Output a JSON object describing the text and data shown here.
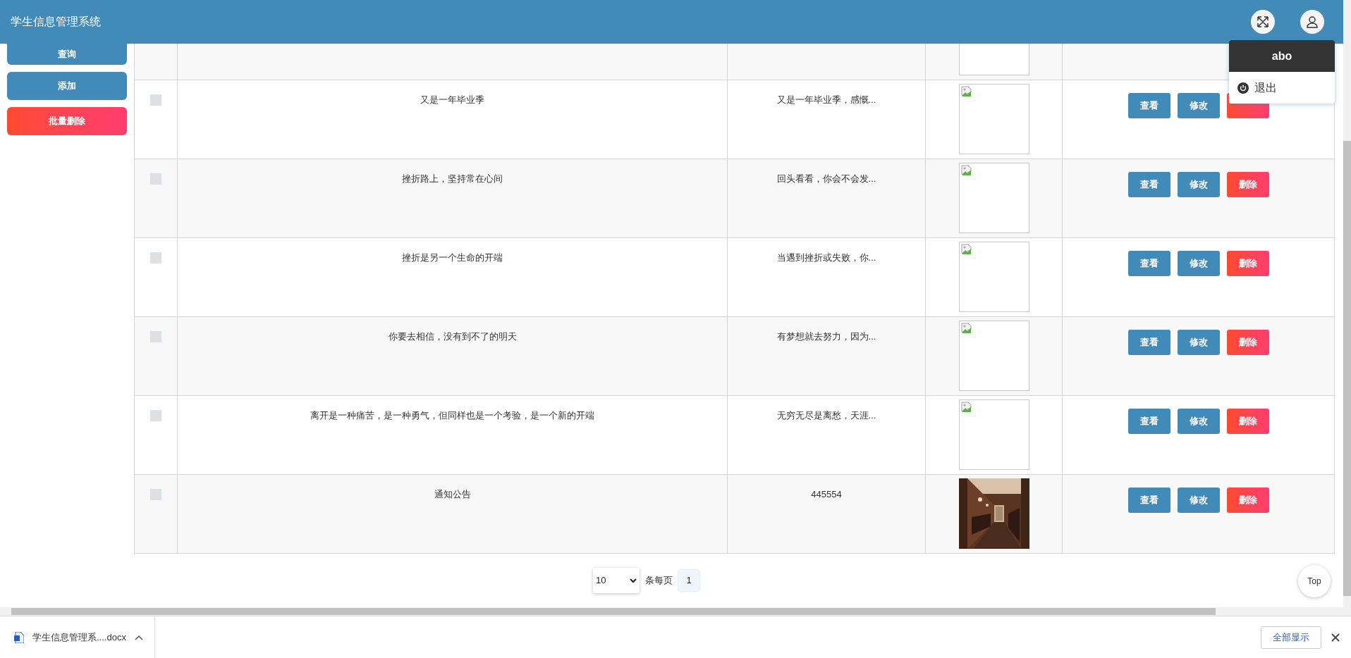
{
  "header": {
    "title": "学生信息管理系统"
  },
  "user_menu": {
    "username": "abo",
    "items": [
      {
        "label": "退出"
      }
    ]
  },
  "sidebar": {
    "buttons": [
      {
        "label": "查询",
        "kind": "primary"
      },
      {
        "label": "添加",
        "kind": "primary"
      },
      {
        "label": "批量删除",
        "kind": "danger"
      }
    ]
  },
  "table": {
    "rows": [
      {
        "kind": "cut"
      },
      {
        "checked": false,
        "title": "又是一年毕业季",
        "summary": "又是一年毕业季，感慨...",
        "image": {
          "kind": "broken"
        },
        "actions": [
          {
            "label": "查看",
            "kind": "view"
          },
          {
            "label": "修改",
            "kind": "edit"
          },
          {
            "kind": "delete"
          }
        ]
      },
      {
        "checked": false,
        "title": "挫折路上，坚持常在心间",
        "summary": "回头看看，你会不会发...",
        "image": {
          "kind": "broken"
        },
        "actions": [
          {
            "label": "查看",
            "kind": "view"
          },
          {
            "label": "修改",
            "kind": "edit"
          },
          {
            "label": "删除",
            "kind": "delete"
          }
        ]
      },
      {
        "checked": false,
        "title": "挫折是另一个生命的开端",
        "summary": "当遇到挫折或失败，你...",
        "image": {
          "kind": "broken"
        },
        "actions": [
          {
            "label": "查看",
            "kind": "view"
          },
          {
            "label": "修改",
            "kind": "edit"
          },
          {
            "label": "删除",
            "kind": "delete"
          }
        ]
      },
      {
        "checked": false,
        "title": "你要去相信，没有到不了的明天",
        "summary": "有梦想就去努力，因为...",
        "image": {
          "kind": "broken"
        },
        "actions": [
          {
            "label": "查看",
            "kind": "view"
          },
          {
            "label": "修改",
            "kind": "edit"
          },
          {
            "label": "删除",
            "kind": "delete"
          }
        ]
      },
      {
        "checked": false,
        "title": "离开是一种痛苦，是一种勇气，但同样也是一个考验，是一个新的开端",
        "summary": "无穷无尽是离愁，天涯...",
        "image": {
          "kind": "broken"
        },
        "actions": [
          {
            "label": "查看",
            "kind": "view"
          },
          {
            "label": "修改",
            "kind": "edit"
          },
          {
            "label": "删除",
            "kind": "delete"
          }
        ]
      },
      {
        "checked": false,
        "title": "通知公告",
        "summary": "445554",
        "actions": [
          {
            "label": "查看",
            "kind": "view"
          },
          {
            "label": "修改",
            "kind": "edit"
          },
          {
            "label": "删除",
            "kind": "delete"
          }
        ]
      }
    ]
  },
  "pagination": {
    "page_size": "10",
    "page_size_label": "条每页",
    "pages": [
      {
        "label": "1",
        "selected": true
      }
    ]
  },
  "back_to_top": {
    "label": "Top"
  },
  "download_bar": {
    "file": "学生信息管理系....docx",
    "show_all": "全部显示"
  }
}
